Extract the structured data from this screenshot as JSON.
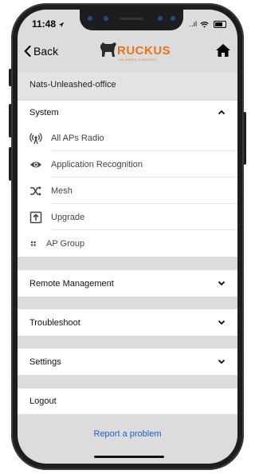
{
  "status": {
    "time": "11:48",
    "signal": "..ıl",
    "wifi": "wifi-icon",
    "battery": "battery-icon"
  },
  "nav": {
    "back_label": "Back",
    "logo_text": "RUCKUS",
    "logo_sub": "AN ARRIS COMPANY",
    "home_icon": "home-icon"
  },
  "site_name": "Nats-Unleashed-office",
  "menu": {
    "system": {
      "label": "System",
      "items": [
        {
          "label": "All APs Radio",
          "icon": "antenna-icon"
        },
        {
          "label": "Application Recognition",
          "icon": "eye-icon"
        },
        {
          "label": "Mesh",
          "icon": "mesh-icon"
        },
        {
          "label": "Upgrade",
          "icon": "upgrade-icon"
        },
        {
          "label": "AP Group",
          "icon": "grid-icon"
        }
      ]
    },
    "remote_management": "Remote Management",
    "troubleshoot": "Troubleshoot",
    "settings": "Settings",
    "logout": "Logout"
  },
  "report_link": "Report a problem",
  "colors": {
    "accent": "#e8741a",
    "link": "#1a5fc8",
    "background": "#dcdcdc"
  }
}
